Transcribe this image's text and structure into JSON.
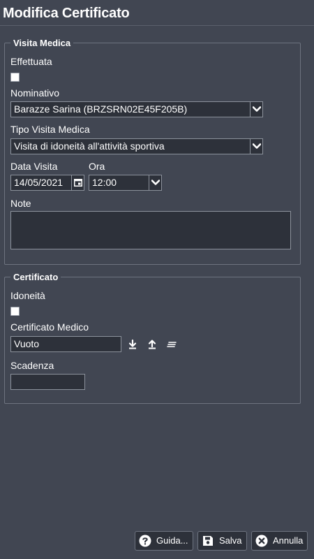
{
  "dialog": {
    "title": "Modifica Certificato"
  },
  "visita": {
    "legend": "Visita Medica",
    "effettuata_label": "Effettuata",
    "effettuata_checked": false,
    "nominativo_label": "Nominativo",
    "nominativo_value": "Barazze Sarina (BRZSRN02E45F205B)",
    "tipo_label": "Tipo Visita Medica",
    "tipo_value": "Visita di idoneità all'attività sportiva",
    "data_label": "Data Visita",
    "data_value": "14/05/2021",
    "ora_label": "Ora",
    "ora_value": "12:00",
    "note_label": "Note",
    "note_value": ""
  },
  "certificato": {
    "legend": "Certificato",
    "idoneita_label": "Idoneità",
    "idoneita_checked": false,
    "cert_label": "Certificato Medico",
    "cert_value": "Vuoto",
    "scadenza_label": "Scadenza",
    "scadenza_value": ""
  },
  "buttons": {
    "help": "Guida...",
    "save": "Salva",
    "cancel": "Annulla"
  },
  "colors": {
    "background": "#414652",
    "field": "#2d313a",
    "border": "#8c929c"
  }
}
